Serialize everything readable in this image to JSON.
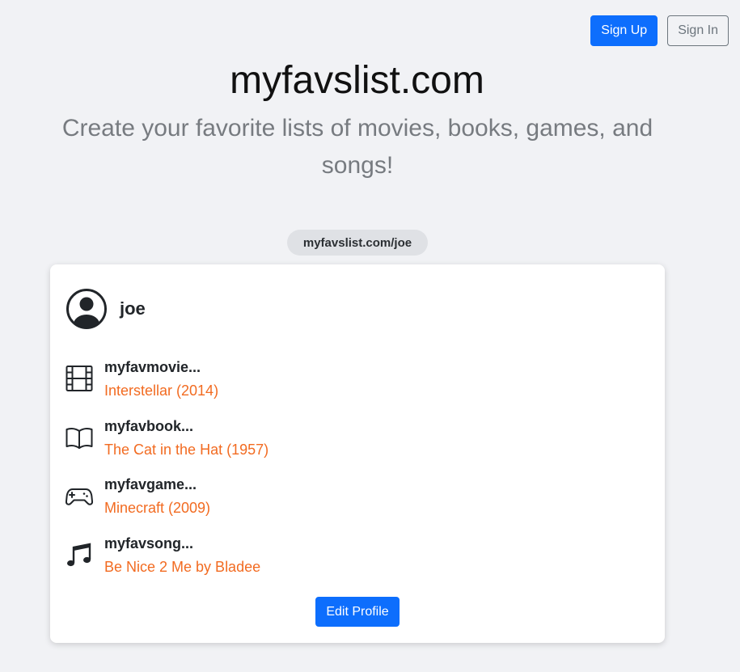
{
  "header": {
    "sign_up_label": "Sign Up",
    "sign_in_label": "Sign In"
  },
  "hero": {
    "title": "myfavslist.com",
    "tagline": "Create your favorite lists of movies, books, games, and songs!"
  },
  "profile_url": "myfavslist.com/joe",
  "profile": {
    "username": "joe",
    "avatar_icon": "user-circle-icon",
    "favorites": [
      {
        "label": "myfavmovie...",
        "value": "Interstellar (2014)",
        "icon": "film-icon"
      },
      {
        "label": "myfavbook...",
        "value": "The Cat in the Hat (1957)",
        "icon": "book-icon"
      },
      {
        "label": "myfavgame...",
        "value": "Minecraft (2009)",
        "icon": "gamepad-icon"
      },
      {
        "label": "myfavsong...",
        "value": "Be Nice 2 Me by Bladee",
        "icon": "music-note-icon"
      }
    ],
    "edit_label": "Edit Profile"
  },
  "colors": {
    "accent": "#0d6efd",
    "favorite_value": "#f26b21",
    "background": "#f1f2f5"
  }
}
